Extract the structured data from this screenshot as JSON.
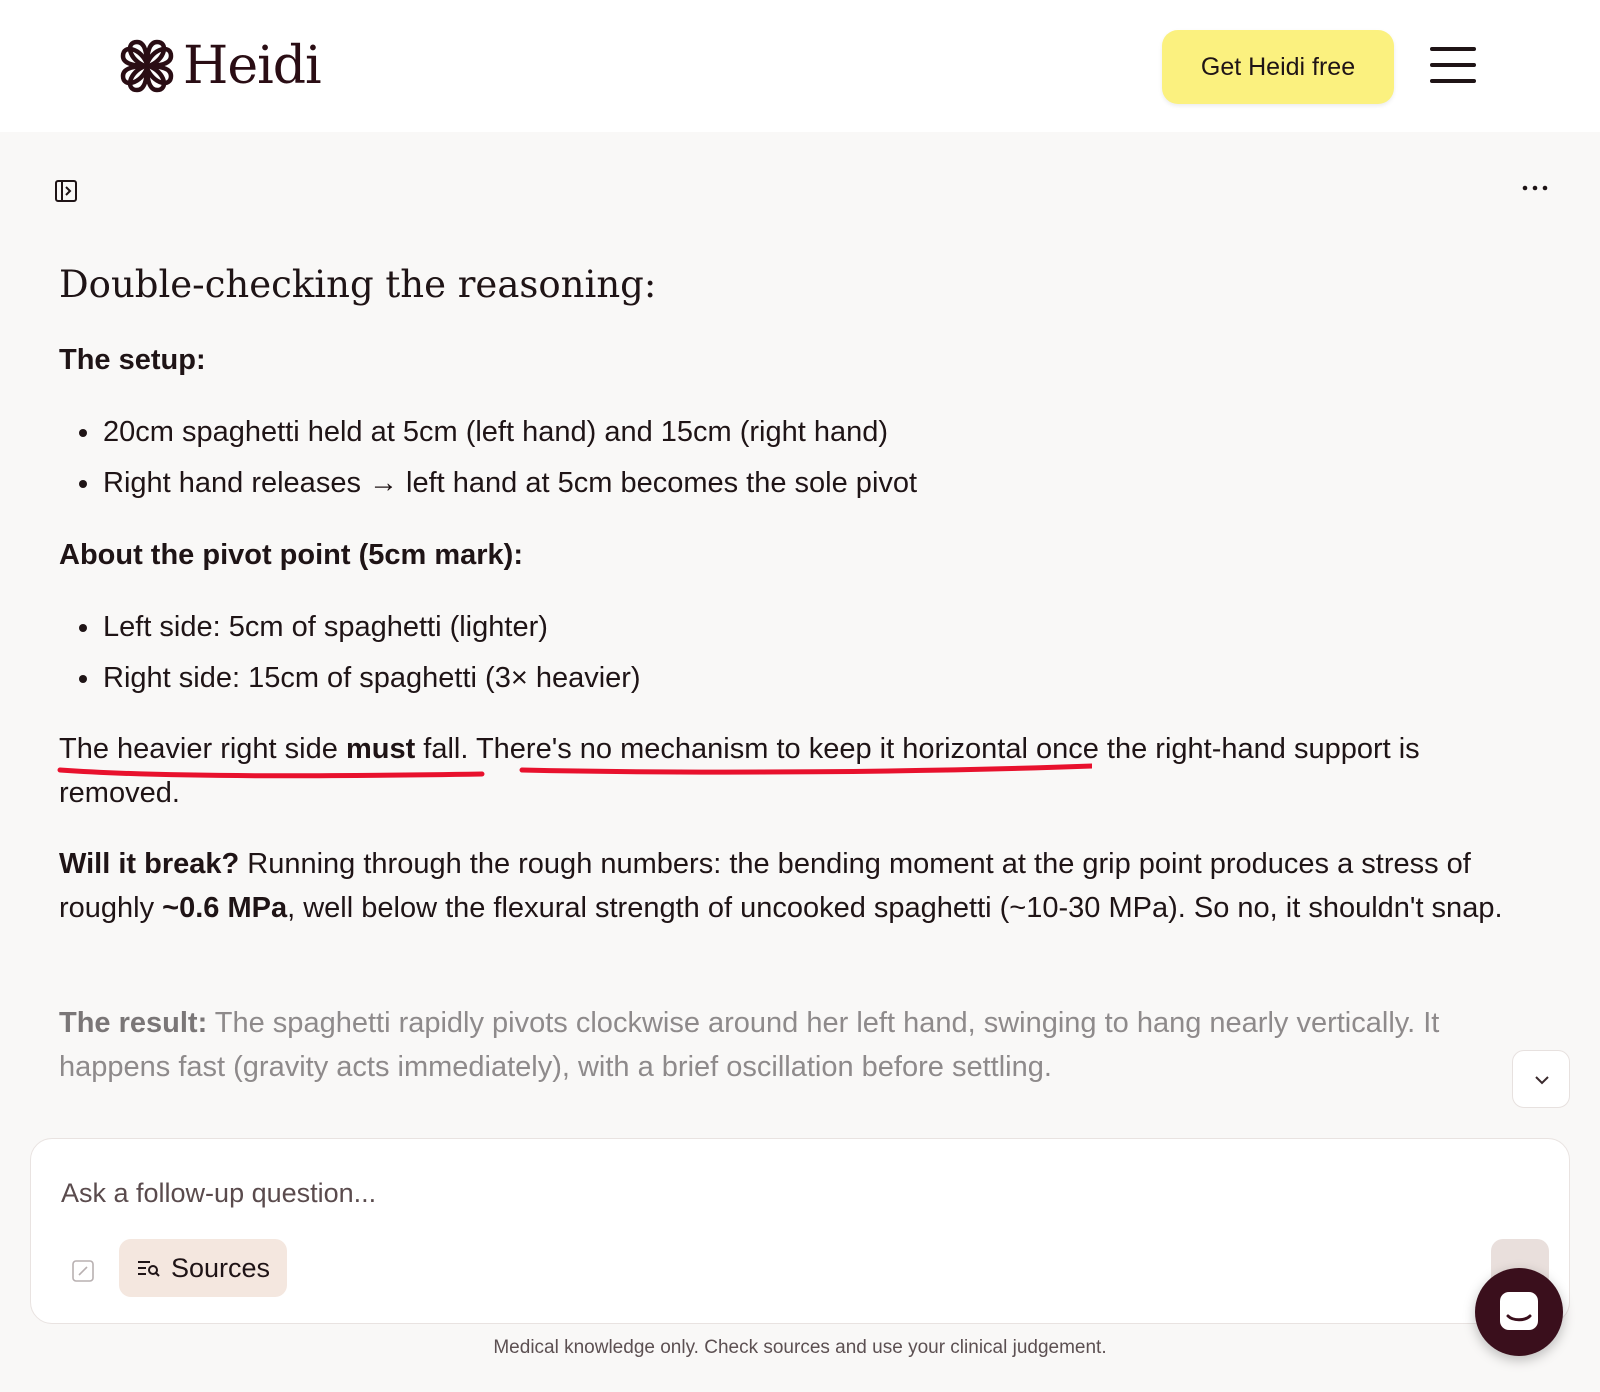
{
  "header": {
    "brand": "Heidi",
    "cta_label": "Get Heidi free"
  },
  "article": {
    "heading": "Double-checking the reasoning:",
    "setup_title": "The setup:",
    "setup_items": [
      "20cm spaghetti held at 5cm (left hand) and 15cm (right hand)",
      "Right hand releases → left hand at 5cm becomes the sole pivot"
    ],
    "pivot_title": "About the pivot point (5cm mark):",
    "pivot_items": [
      "Left side: 5cm of spaghetti (lighter)",
      "Right side: 15cm of spaghetti (3× heavier)"
    ],
    "fall_para": {
      "part1": "The heavier right side ",
      "bold": "must",
      "part2": " fall. There's no mechanism to keep it horizontal once the right-hand support is removed."
    },
    "break_para": {
      "lead": "Will it break?",
      "part1": " Running through the rough numbers: the bending moment at the grip point produces a stress of roughly ",
      "bold": "~0.6 MPa",
      "part2": ", well below the flexural strength of uncooked spaghetti (~10-30 MPa). So no, it shouldn't snap."
    },
    "result_para": {
      "lead": "The result:",
      "text": " The spaghetti rapidly pivots clockwise around her left hand, swinging to hang nearly vertically. It happens fast (gravity acts immediately), with a brief oscillation before settling."
    },
    "annotation_color": "#e8112d"
  },
  "composer": {
    "placeholder": "Ask a follow-up question...",
    "sources_label": "Sources"
  },
  "footer": {
    "disclaimer": "Medical knowledge only. Check sources and use your clinical judgement."
  },
  "colors": {
    "cta": "#fbf17f",
    "brand": "#2a0d14",
    "chat_bubble": "#3a0f1c",
    "sources_bg": "#f4e7df"
  }
}
